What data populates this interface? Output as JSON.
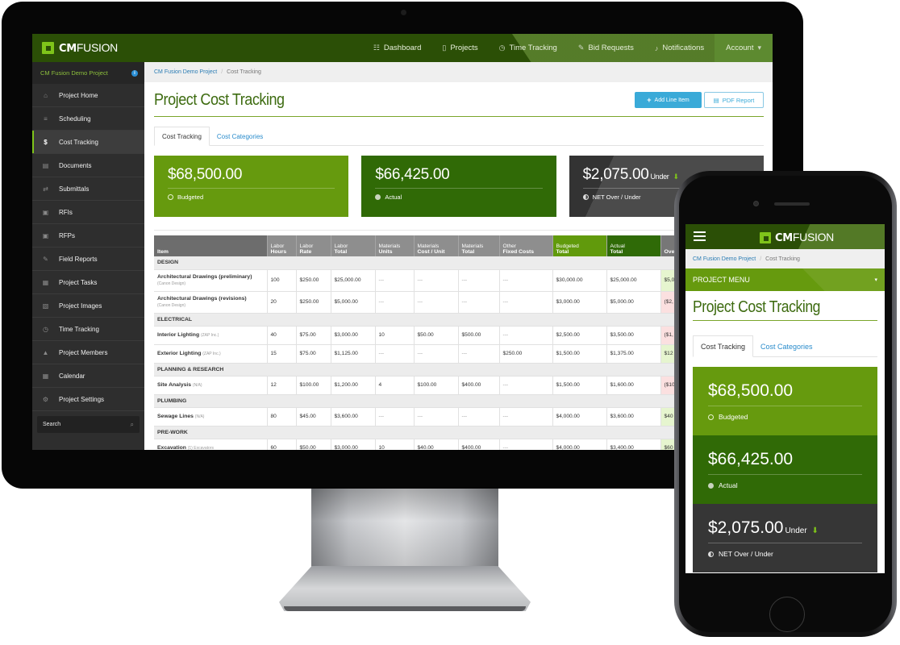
{
  "brand": {
    "name_bold": "CM",
    "name_rest": "FUSION",
    "accent": "#7fc41a",
    "nav_bg": "#2b4f06"
  },
  "topnav": {
    "items": [
      {
        "icon": "grid-icon",
        "glyph": "☷",
        "label": "Dashboard"
      },
      {
        "icon": "tablet-icon",
        "glyph": "▯",
        "label": "Projects"
      },
      {
        "icon": "clock-icon",
        "glyph": "◷",
        "label": "Time Tracking"
      },
      {
        "icon": "edit-icon",
        "glyph": "✎",
        "label": "Bid Requests"
      },
      {
        "icon": "bell-icon",
        "glyph": "♪",
        "label": "Notifications"
      }
    ],
    "account": {
      "label": "Account",
      "caret": "▾"
    }
  },
  "sidebar": {
    "project_name": "CM Fusion Demo Project",
    "info_glyph": "i",
    "items": [
      {
        "icon": "home-icon",
        "glyph": "⌂",
        "label": "Project Home"
      },
      {
        "icon": "scheduling-icon",
        "glyph": "≡",
        "label": "Scheduling"
      },
      {
        "icon": "dollar-icon",
        "glyph": "$",
        "label": "Cost Tracking",
        "active": true
      },
      {
        "icon": "document-icon",
        "glyph": "▤",
        "label": "Documents"
      },
      {
        "icon": "submittals-icon",
        "glyph": "⇄",
        "label": "Submittals"
      },
      {
        "icon": "file-icon",
        "glyph": "▣",
        "label": "RFIs"
      },
      {
        "icon": "file-icon",
        "glyph": "▣",
        "label": "RFPs"
      },
      {
        "icon": "field-report-icon",
        "glyph": "✎",
        "label": "Field Reports"
      },
      {
        "icon": "tasks-icon",
        "glyph": "▦",
        "label": "Project Tasks"
      },
      {
        "icon": "image-icon",
        "glyph": "▧",
        "label": "Project Images"
      },
      {
        "icon": "clock-icon",
        "glyph": "◷",
        "label": "Time Tracking"
      },
      {
        "icon": "user-icon",
        "glyph": "▲",
        "label": "Project Members"
      },
      {
        "icon": "calendar-icon",
        "glyph": "▦",
        "label": "Calendar"
      },
      {
        "icon": "gear-icon",
        "glyph": "⚙",
        "label": "Project Settings"
      }
    ],
    "search": {
      "placeholder": "Search",
      "glyph": "⌕"
    }
  },
  "breadcrumb": {
    "parent": "CM Fusion Demo Project",
    "separator": "/",
    "current": "Cost Tracking"
  },
  "page": {
    "title": "Project Cost Tracking",
    "add_button": {
      "glyph": "+",
      "label": "Add Line Item"
    },
    "pdf_button": {
      "glyph": "▤",
      "label": "PDF Report"
    },
    "tabs": [
      {
        "label": "Cost Tracking",
        "active": true
      },
      {
        "label": "Cost Categories"
      }
    ]
  },
  "summary": {
    "budgeted": {
      "amount": "$68,500.00",
      "label": "Budgeted"
    },
    "actual": {
      "amount": "$66,425.00",
      "label": "Actual"
    },
    "net": {
      "amount": "$2,075.00",
      "suffix": "Under",
      "arrow": "⬇",
      "label": "NET Over / Under"
    }
  },
  "table": {
    "headers": [
      {
        "top": "",
        "bottom": "Item"
      },
      {
        "top": "Labor",
        "bottom": "Hours"
      },
      {
        "top": "Labor",
        "bottom": "Rate"
      },
      {
        "top": "Labor",
        "bottom": "Total"
      },
      {
        "top": "Materials",
        "bottom": "Units"
      },
      {
        "top": "Materials",
        "bottom": "Cost / Unit"
      },
      {
        "top": "Materials",
        "bottom": "Total"
      },
      {
        "top": "Other",
        "bottom": "Fixed Costs"
      },
      {
        "top": "Budgeted",
        "bottom": "Total"
      },
      {
        "top": "Actual",
        "bottom": "Total"
      },
      {
        "top": "",
        "bottom": "Ove"
      }
    ],
    "groups": [
      {
        "category": "DESIGN",
        "rows": [
          {
            "name": "Architectural Drawings (preliminary)",
            "vendor": "(Canon Design)",
            "vendor_block": true,
            "cells": [
              "100",
              "$250.00",
              "$25,000.00",
              "---",
              "---",
              "---",
              "---",
              "$30,000.00",
              "$25,000.00",
              "$5,0"
            ],
            "status": "pos"
          },
          {
            "name": "Architectural Drawings (revisions)",
            "vendor": "(Canon Design)",
            "vendor_block": true,
            "cells": [
              "20",
              "$250.00",
              "$5,000.00",
              "---",
              "---",
              "---",
              "---",
              "$3,000.00",
              "$5,000.00",
              "($2,"
            ],
            "status": "neg"
          }
        ]
      },
      {
        "category": "ELECTRICAL",
        "rows": [
          {
            "name": "Interior Lighting",
            "vendor": "(ZAP Inc.)",
            "cells": [
              "40",
              "$75.00",
              "$3,000.00",
              "10",
              "$50.00",
              "$500.00",
              "---",
              "$2,500.00",
              "$3,500.00",
              "($1,"
            ],
            "status": "neg"
          },
          {
            "name": "Exterior Lighting",
            "vendor": "(ZAP Inc.)",
            "cells": [
              "15",
              "$75.00",
              "$1,125.00",
              "---",
              "---",
              "---",
              "$250.00",
              "$1,500.00",
              "$1,375.00",
              "$12"
            ],
            "status": "pos"
          }
        ]
      },
      {
        "category": "PLANNING & RESEARCH",
        "rows": [
          {
            "name": "Site Analysis",
            "vendor": "(N/A)",
            "cells": [
              "12",
              "$100.00",
              "$1,200.00",
              "4",
              "$100.00",
              "$400.00",
              "---",
              "$1,500.00",
              "$1,600.00",
              "($10"
            ],
            "status": "neg"
          }
        ]
      },
      {
        "category": "PLUMBING",
        "rows": [
          {
            "name": "Sewage Lines",
            "vendor": "(N/A)",
            "cells": [
              "80",
              "$45.00",
              "$3,600.00",
              "---",
              "---",
              "---",
              "---",
              "$4,000.00",
              "$3,600.00",
              "$40"
            ],
            "status": "pos"
          }
        ]
      },
      {
        "category": "PRE-WORK",
        "rows": [
          {
            "name": "Excavation",
            "vendor": "(1) Excavators",
            "cells": [
              "60",
              "$50.00",
              "$3,000.00",
              "10",
              "$40.00",
              "$400.00",
              "---",
              "$4,000.00",
              "$3,400.00",
              "$60"
            ],
            "status": "pos"
          }
        ]
      }
    ]
  },
  "mobile": {
    "project_menu": {
      "label": "PROJECT MENU",
      "caret": "▾"
    }
  }
}
